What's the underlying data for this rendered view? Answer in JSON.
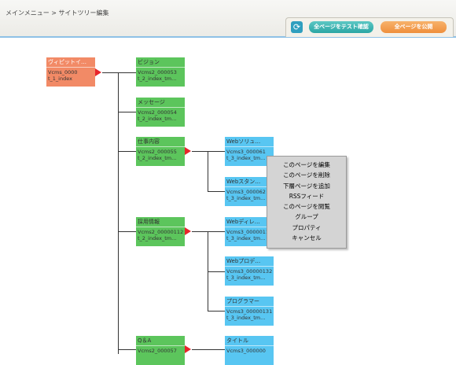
{
  "header": {
    "breadcrumb": "メインメニュー > サイトツリー編集",
    "test_button": "全ページをテスト確認",
    "publish_button": "全ページを公開"
  },
  "nodes": {
    "n0": {
      "title": "ヴィピットイ…",
      "id": "Vcms_0000",
      "tpl": "t_1_index"
    },
    "n1": {
      "title": "ビジョン",
      "id": "Vcms2_000053",
      "tpl": "t_2_index_tm…"
    },
    "n2": {
      "title": "メッセージ",
      "id": "Vcms2_000054",
      "tpl": "t_2_index_tm…"
    },
    "n3": {
      "title": "仕事内容",
      "id": "Vcms2_000055",
      "tpl": "t_2_index_tm…"
    },
    "n4": {
      "title": "Webソリュ…",
      "id": "Vcms3_000061",
      "tpl": "t_3_index_tm…"
    },
    "n5": {
      "title": "Webスタン…",
      "id": "Vcms3_000062",
      "tpl": "t_3_index_tm…"
    },
    "n6": {
      "title": "採用情報",
      "id": "Vcms2_00000112",
      "tpl": "t_2_index_tm…"
    },
    "n7": {
      "title": "Webディレ…",
      "id": "Vcms3_00000111",
      "tpl": "t_3_index_tm…"
    },
    "n8": {
      "title": "Webプロデ…",
      "id": "Vcms3_00000132",
      "tpl": "t_3_index_tm…"
    },
    "n9": {
      "title": "プログラマー",
      "id": "Vcms3_00000131",
      "tpl": "t_3_index_tm…"
    },
    "n10": {
      "title": "Q＆A",
      "id": "Vcms2_000057",
      "tpl": ""
    },
    "n11": {
      "title": "タイトル",
      "id": "Vcms3_000000",
      "tpl": ""
    }
  },
  "context_menu": {
    "items": [
      "このページを編集",
      "このページを削除",
      "下層ページを追加",
      "RSSフィード",
      "このページを閲覧",
      "グループ",
      "プロパティ",
      "キャンセル"
    ]
  },
  "colors": {
    "root": "#f28a66",
    "level2": "#5cc55c",
    "level3": "#58c6f2",
    "arrow": "#e8252b"
  }
}
